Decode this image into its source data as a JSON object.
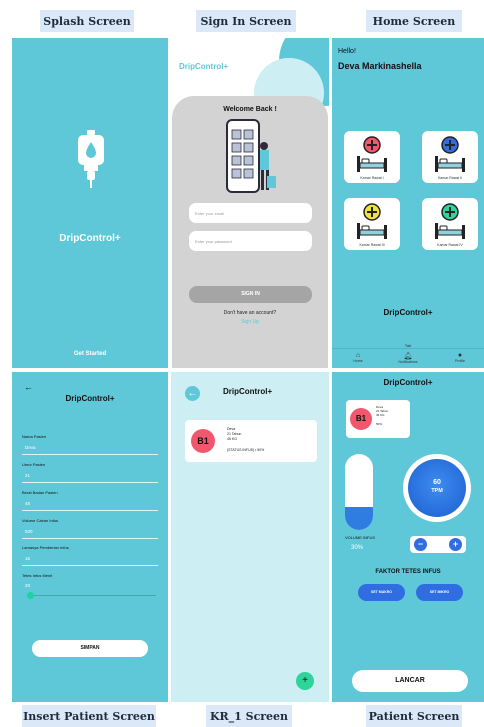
{
  "labels": {
    "splash": "Splash Screen",
    "signin": "Sign In Screen",
    "home": "Home Screen",
    "insert": "Insert Patient Screen",
    "kr1": "KR_1 Screen",
    "patient": "Patient Screen"
  },
  "colors": {
    "teal": "#5ec8d8",
    "light_teal": "#cdeff4",
    "blue": "#2f6de0",
    "coral": "#f2576d",
    "green": "#2ed49a"
  },
  "splash": {
    "brand": "DripControl+",
    "cta": "Get Started"
  },
  "signin": {
    "brand": "DripControl+",
    "welcome": "Welcome Back !",
    "email_placeholder": "Enter your email",
    "password_placeholder": "Enter your password",
    "sign_in": "SIGN IN",
    "no_account": "Don't have an account?",
    "sign_up": "Sign Up"
  },
  "home": {
    "greeting": "Hello!",
    "user": "Deva Markinashella",
    "rooms": [
      "Kamar Rawat I",
      "Kamar Rawat II",
      "Kamar Rawat III",
      "Kamar Rawat IV"
    ],
    "brand": "DripControl+",
    "tab_hint": "Tab",
    "nav": [
      "Home",
      "Notifications",
      "Profile"
    ]
  },
  "insert": {
    "title": "DripControl+",
    "fields": [
      {
        "label": "Nama Pasien",
        "value": "Deva"
      },
      {
        "label": "Umur Pasien",
        "value": "21"
      },
      {
        "label": "Berat Badan Pasien",
        "value": "45"
      },
      {
        "label": "Volume Cairan Infus",
        "value": "500"
      },
      {
        "label": "Lamanya Pemberian Infus",
        "value": "16"
      }
    ],
    "slider_label": "Tetes Infus Menit",
    "slider_value": "20",
    "save": "SIMPAN"
  },
  "kr1": {
    "title": "DripControl+",
    "bed": "B1",
    "patient_name": "Deva",
    "patient_age": "21 Tahun",
    "patient_weight": "45 KG",
    "status": "(STATUS INFUS) • 50%"
  },
  "patient": {
    "title": "DripControl+",
    "bed": "B1",
    "patient_name": "Deva",
    "patient_age": "21 Tahun",
    "patient_weight": "45 KG",
    "patient_pct": "50%",
    "volume_label": "VOLUME INFUS",
    "volume_value": "30%",
    "volume_fraction": 0.3,
    "rate_value": "60",
    "rate_unit": "TPM",
    "minus": "−",
    "plus": "+",
    "factor_title": "FAKTOR TETES INFUS",
    "set_buttons": [
      "SET MAKRO",
      "SET MIKRO"
    ],
    "status": "LANCAR"
  }
}
